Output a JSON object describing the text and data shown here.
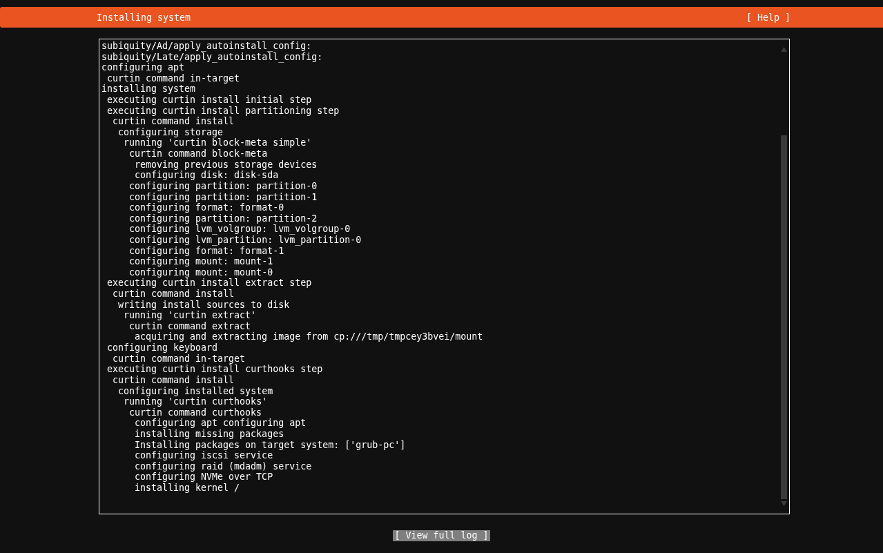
{
  "header": {
    "title": "Installing system",
    "help": "[ Help ]"
  },
  "log": [
    {
      "text": "subiquity/Ad/apply_autoinstall_config:"
    },
    {
      "text": "subiquity/Late/apply_autoinstall_config:"
    },
    {
      "text": "configuring apt",
      "children": [
        {
          "text": "curtin command in-target"
        }
      ]
    },
    {
      "text": "installing system",
      "children": [
        {
          "text": "executing curtin install initial step"
        },
        {
          "text": "executing curtin install partitioning step",
          "children": [
            {
              "text": "curtin command install",
              "children": [
                {
                  "text": "configuring storage",
                  "children": [
                    {
                      "text": "running 'curtin block-meta simple'",
                      "children": [
                        {
                          "text": "curtin command block-meta",
                          "children": [
                            {
                              "text": "removing previous storage devices"
                            },
                            {
                              "text": "configuring disk: disk-sda"
                            }
                          ]
                        },
                        {
                          "text": "configuring partition: partition-0"
                        },
                        {
                          "text": "configuring partition: partition-1"
                        },
                        {
                          "text": "configuring format: format-0"
                        },
                        {
                          "text": "configuring partition: partition-2"
                        },
                        {
                          "text": "configuring lvm_volgroup: lvm_volgroup-0"
                        },
                        {
                          "text": "configuring lvm_partition: lvm_partition-0"
                        },
                        {
                          "text": "configuring format: format-1"
                        },
                        {
                          "text": "configuring mount: mount-1"
                        },
                        {
                          "text": "configuring mount: mount-0"
                        }
                      ]
                    }
                  ]
                }
              ]
            }
          ]
        },
        {
          "text": "executing curtin install extract step",
          "children": [
            {
              "text": "curtin command install",
              "children": [
                {
                  "text": "writing install sources to disk",
                  "children": [
                    {
                      "text": "running 'curtin extract'",
                      "children": [
                        {
                          "text": "curtin command extract",
                          "children": [
                            {
                              "text": "acquiring and extracting image from cp:///tmp/tmpcey3bvei/mount"
                            }
                          ]
                        }
                      ]
                    }
                  ]
                }
              ]
            }
          ]
        },
        {
          "text": "configuring keyboard",
          "children": [
            {
              "text": "curtin command in-target"
            }
          ]
        },
        {
          "text": "executing curtin install curthooks step",
          "children": [
            {
              "text": "curtin command install",
              "children": [
                {
                  "text": "configuring installed system",
                  "children": [
                    {
                      "text": "running 'curtin curthooks'",
                      "children": [
                        {
                          "text": "curtin command curthooks",
                          "children": [
                            {
                              "text": "configuring apt configuring apt"
                            },
                            {
                              "text": "installing missing packages"
                            },
                            {
                              "text": "Installing packages on target system: ['grub-pc']"
                            },
                            {
                              "text": "configuring iscsi service"
                            },
                            {
                              "text": "configuring raid (mdadm) service"
                            },
                            {
                              "text": "configuring NVMe over TCP"
                            },
                            {
                              "text": "installing kernel /"
                            }
                          ]
                        }
                      ]
                    }
                  ]
                }
              ]
            }
          ]
        }
      ]
    }
  ],
  "footer_button": "[ View full log ]"
}
